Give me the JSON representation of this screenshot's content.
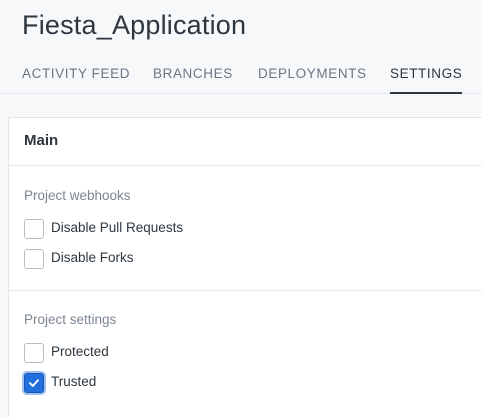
{
  "app": {
    "title": "Fiesta_Application"
  },
  "tabs": [
    {
      "label": "ACTIVITY FEED",
      "active": false
    },
    {
      "label": "BRANCHES",
      "active": false
    },
    {
      "label": "DEPLOYMENTS",
      "active": false
    },
    {
      "label": "SETTINGS",
      "active": true
    }
  ],
  "panel": {
    "title": "Main",
    "webhooks": {
      "label": "Project webhooks",
      "options": [
        {
          "label": "Disable Pull Requests",
          "checked": false
        },
        {
          "label": "Disable Forks",
          "checked": false
        }
      ]
    },
    "settings": {
      "label": "Project settings",
      "options": [
        {
          "label": "Protected",
          "checked": false
        },
        {
          "label": "Trusted",
          "checked": true
        }
      ]
    }
  },
  "colors": {
    "accent": "#1f6fdc",
    "background": "#f7f8fa",
    "panel": "#ffffff"
  }
}
